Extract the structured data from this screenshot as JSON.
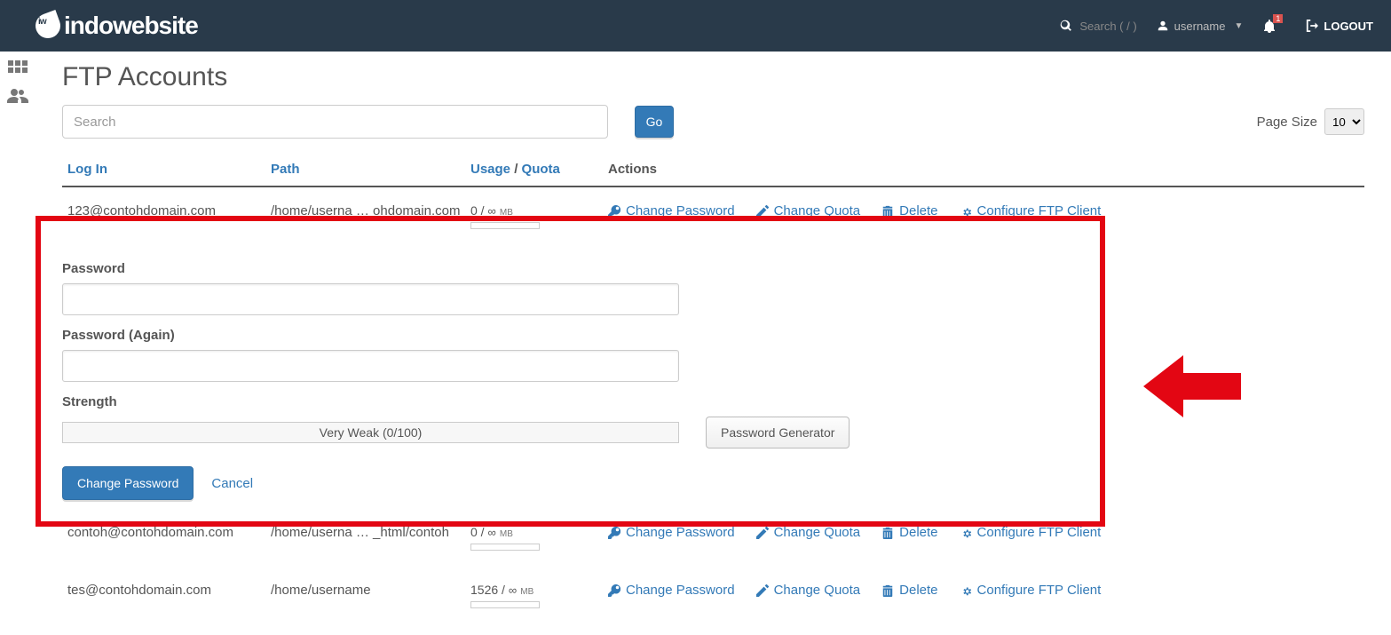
{
  "brand": "indowebsite",
  "topbar": {
    "search_placeholder": "Search ( / )",
    "username": "username",
    "logout": "LOGOUT",
    "notif_count": "1"
  },
  "page": {
    "title": "FTP Accounts",
    "search_placeholder": "Search",
    "go": "Go",
    "page_size_label": "Page Size",
    "page_size_value": "10"
  },
  "columns": {
    "login": "Log In",
    "path": "Path",
    "usage": "Usage",
    "quota": "Quota",
    "actions": "Actions"
  },
  "action_labels": {
    "change_password": "Change Password",
    "change_quota": "Change Quota",
    "delete": "Delete",
    "configure": "Configure FTP Client"
  },
  "password_form": {
    "password_label": "Password",
    "password_again_label": "Password (Again)",
    "strength_label": "Strength",
    "strength_text": "Very Weak (0/100)",
    "generator": "Password Generator",
    "submit": "Change Password",
    "cancel": "Cancel"
  },
  "rows": [
    {
      "login": "123@contohdomain.com",
      "path": "/home/userna … ohdomain.com",
      "usage": "0",
      "quota": "∞",
      "unit": "MB"
    },
    {
      "login": "contoh@contohdomain.com",
      "path": "/home/userna … _html/contoh",
      "usage": "0",
      "quota": "∞",
      "unit": "MB"
    },
    {
      "login": "tes@contohdomain.com",
      "path": "/home/username",
      "usage": "1526",
      "quota": "∞",
      "unit": "MB"
    }
  ]
}
